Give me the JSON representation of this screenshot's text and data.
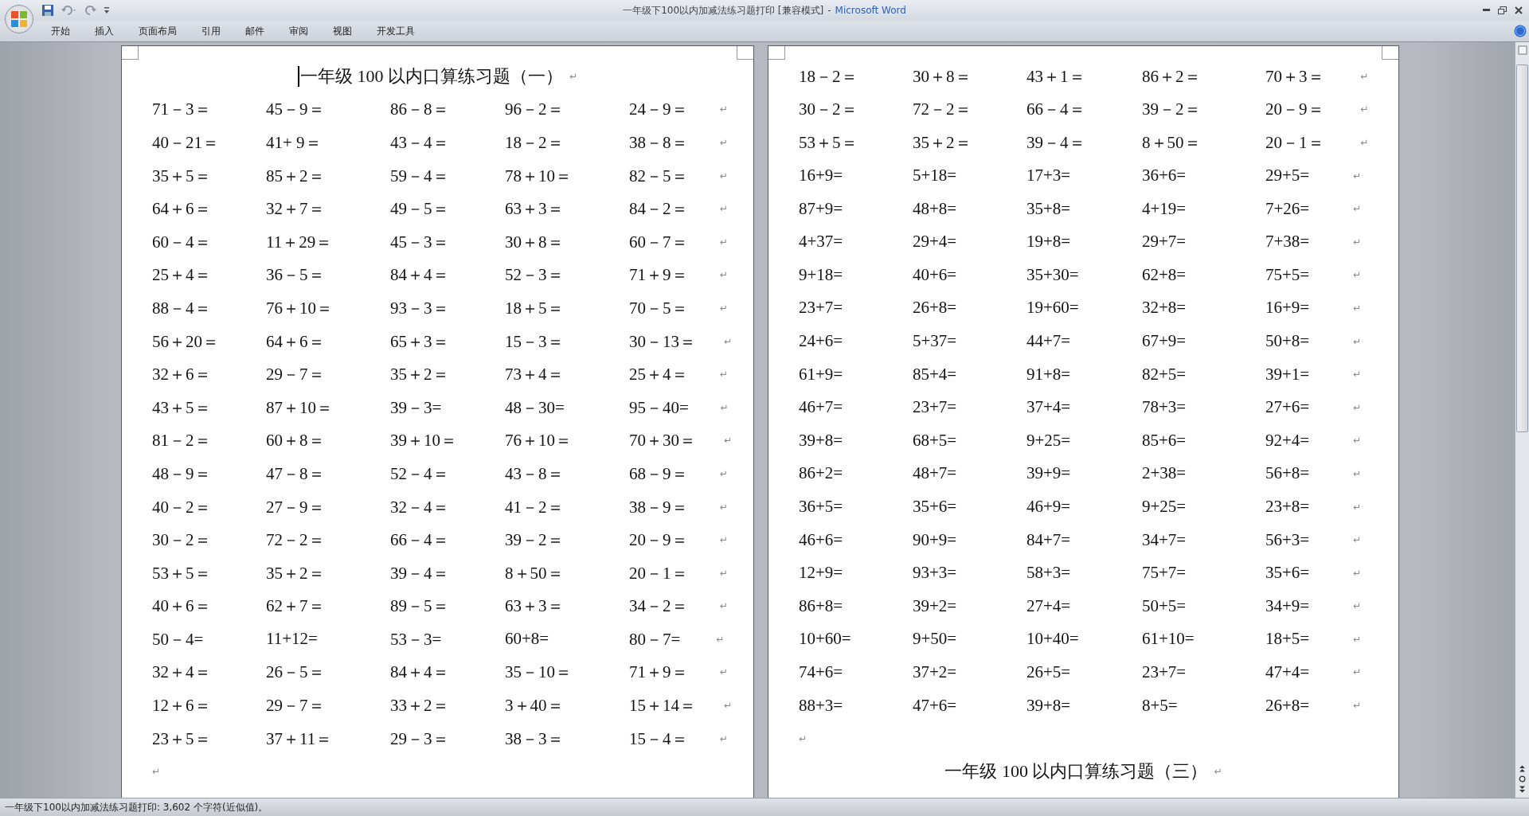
{
  "window": {
    "title": "一年级下100以内加减法练习题打印 [兼容模式]",
    "app_name": "Microsoft Word",
    "separator": "-"
  },
  "ribbon_tabs": [
    {
      "label": "开始",
      "selected": false
    },
    {
      "label": "插入",
      "selected": false
    },
    {
      "label": "页面布局",
      "selected": false
    },
    {
      "label": "引用",
      "selected": false
    },
    {
      "label": "邮件",
      "selected": false
    },
    {
      "label": "审阅",
      "selected": false
    },
    {
      "label": "视图",
      "selected": false
    },
    {
      "label": "开发工具",
      "selected": false
    }
  ],
  "pages": [
    {
      "blocks": [
        {
          "kind": "title",
          "text": "一年级 100 以内口算练习题（一）",
          "end_mark": "↵",
          "cursor": true
        },
        {
          "kind": "row",
          "cells": [
            "71－3＝",
            "45－9＝",
            "86－8＝",
            "96－2＝",
            "24－9＝"
          ],
          "end_mark": "↵"
        },
        {
          "kind": "row",
          "cells": [
            "40－21＝",
            "41+ 9＝",
            "43－4＝",
            "18－2＝",
            "38－8＝"
          ],
          "end_mark": "↵"
        },
        {
          "kind": "row",
          "cells": [
            "35＋5＝",
            "85＋2＝",
            "59－4＝",
            "78＋10＝",
            "82－5＝"
          ],
          "end_mark": "↵"
        },
        {
          "kind": "row",
          "cells": [
            "64＋6＝",
            "32＋7＝",
            "49－5＝",
            "63＋3＝",
            "84－2＝"
          ],
          "end_mark": "↵"
        },
        {
          "kind": "row",
          "cells": [
            "60－4＝",
            "11＋29＝",
            "45－3＝",
            "30＋8＝",
            "60－7＝"
          ],
          "end_mark": "↵"
        },
        {
          "kind": "row",
          "cells": [
            "25＋4＝",
            "36－5＝",
            "84＋4＝",
            "52－3＝",
            "71＋9＝"
          ],
          "end_mark": "↵"
        },
        {
          "kind": "row",
          "cells": [
            "88－4＝",
            "76＋10＝",
            "93－3＝",
            "18＋5＝",
            "70－5＝"
          ],
          "end_mark": "↵"
        },
        {
          "kind": "row",
          "cells": [
            "56＋20＝",
            "64＋6＝",
            "65＋3＝",
            "15－3＝",
            "30－13＝"
          ],
          "end_mark": "↵"
        },
        {
          "kind": "row",
          "cells": [
            "32＋6＝",
            "29－7＝",
            "35＋2＝",
            "73＋4＝",
            "25＋4＝"
          ],
          "end_mark": "↵"
        },
        {
          "kind": "row",
          "cells": [
            "43＋5＝",
            "87＋10＝",
            "39－3=",
            "48－30=",
            "95－40="
          ],
          "end_mark": "↵"
        },
        {
          "kind": "row",
          "cells": [
            "81－2＝",
            "60＋8＝",
            "39＋10＝",
            "76＋10＝",
            "70＋30＝"
          ],
          "end_mark": "↵"
        },
        {
          "kind": "row",
          "cells": [
            "48－9＝",
            "47－8＝",
            "52－4＝",
            "43－8＝",
            "68－9＝"
          ],
          "end_mark": "↵"
        },
        {
          "kind": "row",
          "cells": [
            "40－2＝",
            "27－9＝",
            "32－4＝",
            "41－2＝",
            "38－9＝"
          ],
          "end_mark": "↵"
        },
        {
          "kind": "row",
          "cells": [
            "30－2＝",
            "72－2＝",
            "66－4＝",
            "39－2＝",
            "20－9＝"
          ],
          "end_mark": "↵"
        },
        {
          "kind": "row",
          "cells": [
            "53＋5＝",
            "35＋2＝",
            "39－4＝",
            "8＋50＝",
            "20－1＝"
          ],
          "end_mark": "↵"
        },
        {
          "kind": "row",
          "cells": [
            "40＋6＝",
            "62＋7＝",
            "89－5＝",
            "63＋3＝",
            "34－2＝"
          ],
          "end_mark": "↵"
        },
        {
          "kind": "row",
          "cells": [
            "50－4=",
            "11+12=",
            "53－3=",
            "60+8=",
            "80－7="
          ],
          "end_mark": "↵"
        },
        {
          "kind": "row",
          "cells": [
            "32＋4＝",
            "26－5＝",
            "84＋4＝",
            "35－10＝",
            "71＋9＝"
          ],
          "end_mark": "↵"
        },
        {
          "kind": "row",
          "cells": [
            "12＋6＝",
            "29－7＝",
            "33＋2＝",
            "3＋40＝",
            "15＋14＝"
          ],
          "end_mark": "↵"
        },
        {
          "kind": "row",
          "cells": [
            "23＋5＝",
            "37＋11＝",
            "29－3＝",
            "38－3＝",
            "15－4＝"
          ],
          "end_mark": "↵"
        },
        {
          "kind": "empty",
          "end_mark": "↵"
        }
      ]
    },
    {
      "blocks": [
        {
          "kind": "row",
          "cells": [
            "18－2＝",
            "30＋8＝",
            "43＋1＝",
            "86＋2＝",
            "70＋3＝"
          ],
          "end_mark": "↵"
        },
        {
          "kind": "row",
          "cells": [
            "30－2＝",
            "72－2＝",
            "66－4＝",
            "39－2＝",
            "20－9＝"
          ],
          "end_mark": "↵"
        },
        {
          "kind": "row",
          "cells": [
            "53＋5＝",
            "35＋2＝",
            "39－4＝",
            "8＋50＝",
            "20－1＝"
          ],
          "end_mark": "↵"
        },
        {
          "kind": "row",
          "cells": [
            "16+9=",
            "5+18=",
            "17+3=",
            "36+6=",
            "29+5="
          ],
          "end_mark": "↵"
        },
        {
          "kind": "row",
          "cells": [
            "87+9=",
            "48+8=",
            "35+8=",
            "4+19=",
            "7+26="
          ],
          "end_mark": "↵"
        },
        {
          "kind": "row",
          "cells": [
            "4+37=",
            "29+4=",
            "19+8=",
            "29+7=",
            "7+38="
          ],
          "end_mark": "↵"
        },
        {
          "kind": "row",
          "cells": [
            "9+18=",
            "40+6=",
            "35+30=",
            "62+8=",
            "75+5="
          ],
          "end_mark": "↵"
        },
        {
          "kind": "row",
          "cells": [
            "23+7=",
            "26+8=",
            "19+60=",
            "32+8=",
            "16+9="
          ],
          "end_mark": "↵"
        },
        {
          "kind": "row",
          "cells": [
            "24+6=",
            "5+37=",
            "44+7=",
            "67+9=",
            "50+8="
          ],
          "end_mark": "↵"
        },
        {
          "kind": "row",
          "cells": [
            "61+9=",
            "85+4=",
            "91+8=",
            "82+5=",
            "39+1="
          ],
          "end_mark": "↵"
        },
        {
          "kind": "row",
          "cells": [
            "46+7=",
            "23+7=",
            "37+4=",
            "78+3=",
            "27+6="
          ],
          "end_mark": "↵"
        },
        {
          "kind": "row",
          "cells": [
            "39+8=",
            "68+5=",
            "9+25=",
            "85+6=",
            "92+4="
          ],
          "end_mark": "↵"
        },
        {
          "kind": "row",
          "cells": [
            "86+2=",
            "48+7=",
            "39+9=",
            "2+38=",
            "56+8="
          ],
          "end_mark": "↵"
        },
        {
          "kind": "row",
          "cells": [
            "36+5=",
            "35+6=",
            "46+9=",
            "9+25=",
            "23+8="
          ],
          "end_mark": "↵"
        },
        {
          "kind": "row",
          "cells": [
            "46+6=",
            "90+9=",
            "84+7=",
            "34+7=",
            "56+3="
          ],
          "end_mark": "↵"
        },
        {
          "kind": "row",
          "cells": [
            "12+9=",
            "93+3=",
            "58+3=",
            "75+7=",
            "35+6="
          ],
          "end_mark": "↵"
        },
        {
          "kind": "row",
          "cells": [
            "86+8=",
            "39+2=",
            "27+4=",
            "50+5=",
            "34+9="
          ],
          "end_mark": "↵"
        },
        {
          "kind": "row",
          "cells": [
            "10+60=",
            "9+50=",
            "10+40=",
            "61+10=",
            "18+5="
          ],
          "end_mark": "↵"
        },
        {
          "kind": "row",
          "cells": [
            "74+6=",
            "37+2=",
            "26+5=",
            "23+7=",
            "47+4="
          ],
          "end_mark": "↵"
        },
        {
          "kind": "row",
          "cells": [
            "88+3=",
            "47+6=",
            "39+8=",
            "8+5=",
            "26+8="
          ],
          "end_mark": "↵"
        },
        {
          "kind": "empty",
          "end_mark": "↵"
        },
        {
          "kind": "title",
          "text": "一年级 100 以内口算练习题（三）",
          "end_mark": "↵",
          "cursor": false
        }
      ]
    }
  ],
  "status_bar": {
    "text": "一年级下100以内加减法练习题打印: 3,602 个字符(近似值)。"
  }
}
